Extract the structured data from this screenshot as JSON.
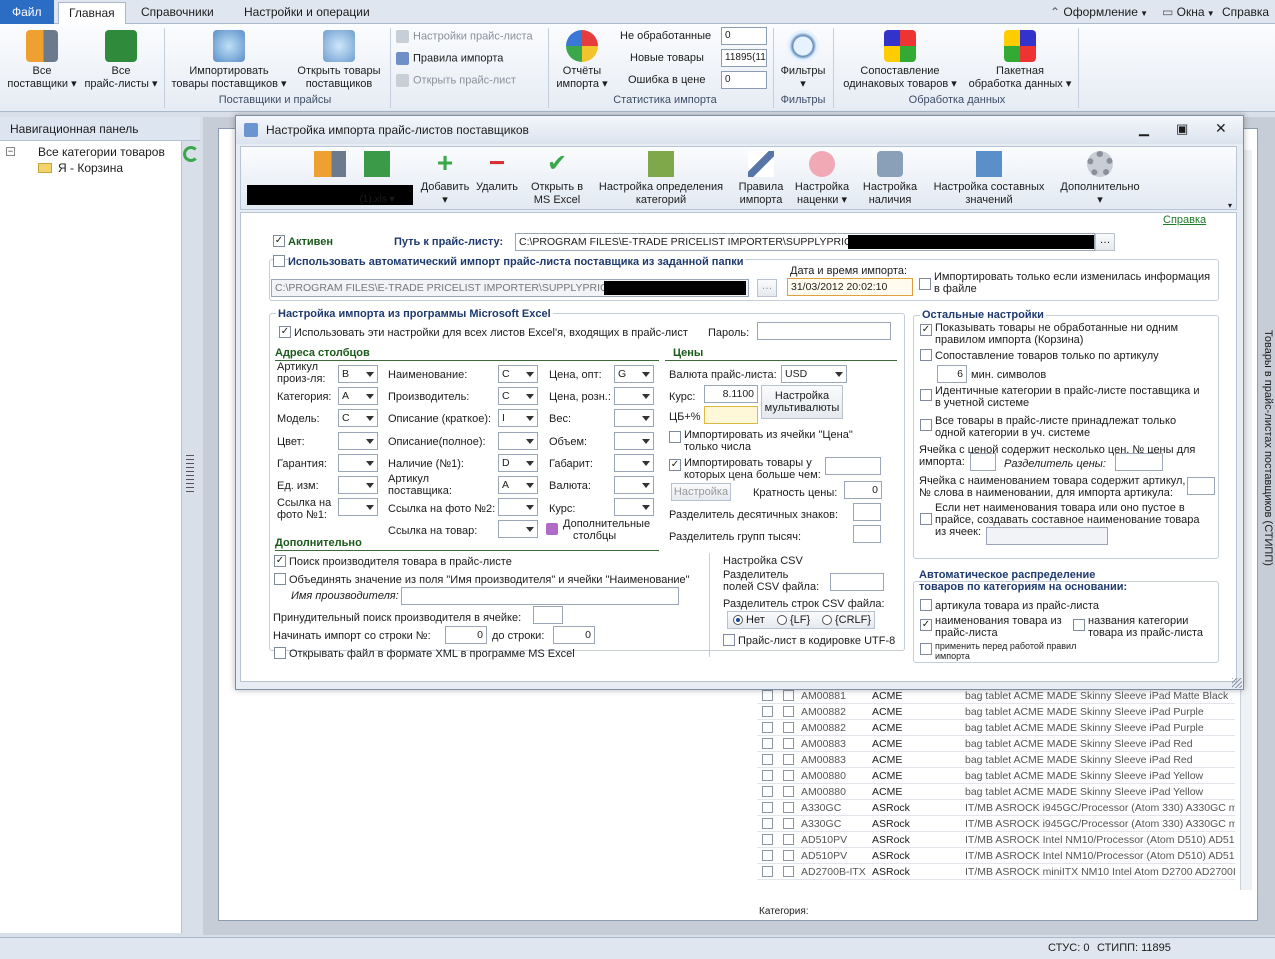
{
  "tabs": {
    "file": "Файл",
    "home": "Главная",
    "refs": "Справочники",
    "settings": "Настройки и операции",
    "theme": "Оформление",
    "windows": "Окна",
    "help": "Справка"
  },
  "ribbon": {
    "all_suppliers": [
      "Все",
      "поставщики"
    ],
    "all_pricelists": [
      "Все",
      "прайс-листы"
    ],
    "import_goods": [
      "Импортировать",
      "товары поставщиков"
    ],
    "open_goods": [
      "Открыть товары",
      "поставщиков"
    ],
    "grp_suppliers": "Поставщики и прайсы",
    "pricelist_settings": "Настройки прайс-листа",
    "import_rules": "Правила импорта",
    "open_pricelist": "Открыть прайс-лист",
    "reports": [
      "Отчёты",
      "импорта"
    ],
    "not_processed_label": "Не обработанные",
    "not_processed_value": "0",
    "new_goods_label": "Новые товары",
    "new_goods_value": "11895(11",
    "price_error_label": "Ошибка в цене",
    "price_error_value": "0",
    "grp_stats": "Статистика импорта",
    "filters": "Фильтры",
    "grp_filters": "Фильтры",
    "compare": [
      "Сопоставление",
      "одинаковых товаров"
    ],
    "batch": [
      "Пакетная",
      "обработка данных"
    ],
    "grp_processing": "Обработка данных"
  },
  "nav": {
    "title": "Навигационная панель",
    "root": "Все категории товаров",
    "child": "Я - Корзина"
  },
  "side_tab": "Товары в прайс-листах поставщиков (СТИПП)",
  "grid": {
    "rows": [
      [
        "AM00881",
        "ACME",
        "bag tablet ACME MADE Skinny Sleeve iPad Matte Black"
      ],
      [
        "AM00882",
        "ACME",
        "bag tablet ACME MADE Skinny Sleeve iPad Purple"
      ],
      [
        "AM00882",
        "ACME",
        "bag tablet ACME MADE Skinny Sleeve iPad Purple"
      ],
      [
        "AM00883",
        "ACME",
        "bag tablet ACME MADE Skinny Sleeve iPad Red"
      ],
      [
        "AM00883",
        "ACME",
        "bag tablet ACME MADE Skinny Sleeve iPad Red"
      ],
      [
        "AM00880",
        "ACME",
        "bag tablet ACME MADE Skinny Sleeve iPad Yellow"
      ],
      [
        "AM00880",
        "ACME",
        "bag tablet ACME MADE Skinny Sleeve iPad Yellow"
      ],
      [
        "A330GC",
        "ASRock",
        "IT/MB ASROCK i945GC/Processor (Atom 330) A330GC m"
      ],
      [
        "A330GC",
        "ASRock",
        "IT/MB ASROCK i945GC/Processor (Atom 330) A330GC m"
      ],
      [
        "AD510PV",
        "ASRock",
        "IT/MB ASROCK Intel NM10/Processor (Atom D510) AD51"
      ],
      [
        "AD510PV",
        "ASRock",
        "IT/MB ASROCK Intel NM10/Processor (Atom D510) AD51"
      ],
      [
        "AD2700B-ITX",
        "ASRock",
        "IT/MB ASROCK miniITX NM10 Intel Atom D2700 AD2700I"
      ]
    ],
    "category_label": "Категория:"
  },
  "status": {
    "stus": "СТУС: 0",
    "stipp": "СТИПП: 11895"
  },
  "dialog": {
    "title": "Настройка импорта прайс-листов поставщиков",
    "toolbar": {
      "file": "(1).xls",
      "add": "Добавить",
      "remove": "Удалить",
      "open_excel": [
        "Открыть в",
        "MS Excel"
      ],
      "cat_detect": [
        "Настройка определения",
        "категорий"
      ],
      "rules": [
        "Правила",
        "импорта"
      ],
      "markup": [
        "Настройка",
        "наценки"
      ],
      "availability": [
        "Настройка",
        "наличия"
      ],
      "composite": [
        "Настройка составных",
        "значений"
      ],
      "extra": "Дополнительно"
    },
    "help_link": "Справка",
    "active": "Активен",
    "path_label": "Путь к прайс-листу:",
    "path_value": "C:\\PROGRAM FILES\\E-TRADE PRICELIST IMPORTER\\SUPPLYPRICES\\",
    "auto_import": "Использовать автоматический импорт прайс-листа поставщика из заданной папки",
    "auto_path": "C:\\PROGRAM FILES\\E-TRADE PRICELIST IMPORTER\\SUPPLYPRICES\\",
    "date_label": "Дата и время импорта:",
    "date_value": "31/03/2012 20:02:10",
    "only_changed": [
      "Импортировать только если изменилась информация",
      "в файле"
    ],
    "excel_section": "Настройка импорта из программы Microsoft Excel",
    "use_all_sheets": "Использовать эти настройки для всех листов Excel'я, входящих в прайс-лист",
    "password": "Пароль:",
    "col_addresses": "Адреса столбцов",
    "prices": "Цены",
    "fields": {
      "art_maker": [
        "Артикул",
        "произ-ля:"
      ],
      "category": "Категория:",
      "model": "Модель:",
      "color": "Цвет:",
      "warranty": "Гарантия:",
      "unit": "Ед. изм:",
      "photo1": [
        "Ссылка на",
        "фото №1:"
      ],
      "name": "Наименование:",
      "maker": "Производитель:",
      "desc_short": "Описание (краткое):",
      "desc_full": "Описание(полное):",
      "avail": "Наличие (№1):",
      "art_supplier": [
        "Артикул",
        "поставщика:"
      ],
      "photo2": "Ссылка на фото №2:",
      "link_goods": "Ссылка на товар:",
      "price_opt": "Цена, опт:",
      "price_retail": "Цена, розн.:",
      "weight": "Вес:",
      "volume": "Объем:",
      "size": "Габарит:",
      "currency": "Валюта:",
      "rate": "Курс:",
      "v_art": "B",
      "v_cat": "A",
      "v_model": "C",
      "v_name": "C",
      "v_maker": "C",
      "v_desc": "I",
      "v_avail": "D",
      "v_artsup": "A",
      "v_price": "G"
    },
    "extra_cols": [
      "Дополнительные",
      "столбцы"
    ],
    "pl_currency": "Валюта прайс-листа:",
    "pl_currency_value": "USD",
    "rate_label": "Курс:",
    "rate_value": "8.1100",
    "cb_label": "ЦБ+%",
    "multicurrency": [
      "Настройка",
      "мультивалюты"
    ],
    "import_price_cells": [
      "Импортировать из ячейки \"Цена\"",
      "только числа"
    ],
    "import_price_gt": [
      "Импортировать товары у",
      "которых цена больше чем:"
    ],
    "setting_btn": "Настройка",
    "multiplicity": "Кратность цены:",
    "multiplicity_value": "0",
    "decimal_sep": "Разделитель десятичных знаков:",
    "group_sep": "Разделитель групп тысяч:",
    "additional": "Дополнительно",
    "search_maker": "Поиск производителя товара в прайс-листе",
    "join_maker": "Объединять значение из поля \"Имя производителя\" и ячейки \"Наименование\"",
    "maker_name": "Имя производителя:",
    "forced_search": "Принудительный поиск производителя в ячейке:",
    "start_row": "Начинать импорт со строки №:",
    "start_value": "0",
    "to_row": "до строки:",
    "to_value": "0",
    "open_xml": "Открывать файл в формате XML в программе MS Excel",
    "csv_title": "Настройка CSV",
    "csv_field_sep": [
      "Разделитель",
      "полей CSV файла:"
    ],
    "csv_row_sep": "Разделитель строк CSV файла:",
    "csv_opts": [
      "Нет",
      "{LF}",
      "{CRLF}"
    ],
    "utf8": "Прайс-лист в кодировке UTF-8",
    "other_title": "Остальные настройки",
    "other": {
      "show_unprocessed": [
        "Показывать товары не обработанные ни одним",
        "правилом импорта (Корзина)"
      ],
      "match_by_art": "Сопоставление товаров только по артикулу",
      "min_chars_value": "6",
      "min_chars": "мин. символов",
      "ident_cats": [
        "Идентичные категории в прайс-листе поставщика и",
        "в учетной системе"
      ],
      "all_one_cat": [
        "Все товары в прайс-листе принадлежат только",
        "одной категории в уч. системе"
      ],
      "multi_price": [
        "Ячейка с ценой содержит несколько цен, № цены для",
        "импорта:"
      ],
      "price_sep": "Разделитель цены:",
      "name_art": [
        "Ячейка с наименованием товара содержит артикул,",
        "№ слова в наименовании, для импорта артикула:"
      ],
      "no_name": [
        "Если нет наименования товара или оно пустое в",
        "прайсе, создавать составное наименование товара",
        "из ячеек:"
      ]
    },
    "auto_dist_title": [
      "Автоматическое распределение",
      "товаров по категориям на основании:"
    ],
    "auto_dist": {
      "by_art": "артикула товара из прайс-листа",
      "by_name": [
        "наименования товара из",
        "прайс-листа"
      ],
      "by_cat": [
        "названия  категории",
        "товара из прайс-листа"
      ],
      "apply_before": [
        "применить перед работой правил",
        "импорта"
      ]
    }
  }
}
